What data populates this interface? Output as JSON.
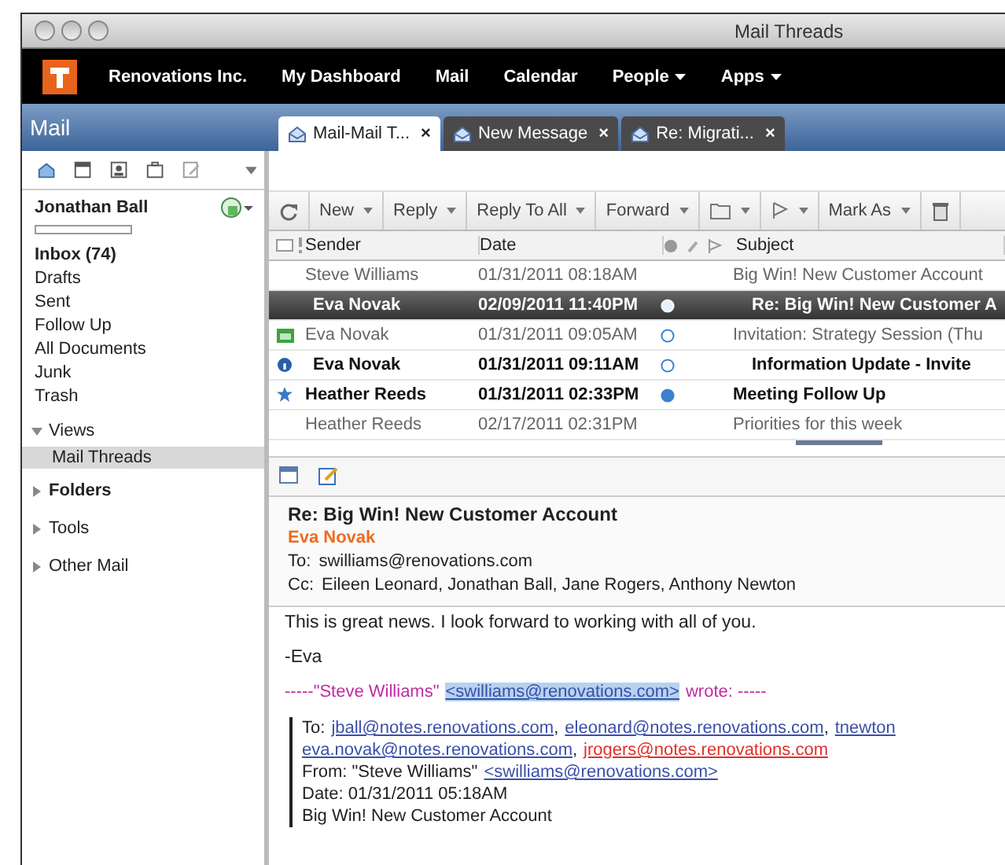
{
  "window": {
    "title": "Mail Threads"
  },
  "nav": {
    "items": [
      {
        "label": "Renovations Inc.",
        "dropdown": false
      },
      {
        "label": "My Dashboard",
        "dropdown": false
      },
      {
        "label": "Mail",
        "dropdown": false
      },
      {
        "label": "Calendar",
        "dropdown": false
      },
      {
        "label": "People",
        "dropdown": true
      },
      {
        "label": "Apps",
        "dropdown": true
      }
    ]
  },
  "app_header": {
    "title": "Mail"
  },
  "tabs": [
    {
      "label": "Mail-Mail T...",
      "selected": true,
      "close": "×"
    },
    {
      "label": "New Message",
      "selected": false,
      "close": "×"
    },
    {
      "label": "Re: Migrati...",
      "selected": false,
      "close": "×"
    }
  ],
  "sidebar": {
    "account": "Jonathan Ball",
    "folders": [
      {
        "label": "Inbox (74)",
        "bold": true
      },
      {
        "label": "Drafts",
        "bold": false
      },
      {
        "label": "Sent",
        "bold": false
      },
      {
        "label": "Follow Up",
        "bold": false
      },
      {
        "label": "All Documents",
        "bold": false
      },
      {
        "label": "Junk",
        "bold": false
      },
      {
        "label": "Trash",
        "bold": false
      }
    ],
    "sections": [
      {
        "label": "Views",
        "expanded": true,
        "bold": false,
        "children": [
          {
            "label": "Mail Threads",
            "selected": true
          }
        ]
      },
      {
        "label": "Folders",
        "expanded": false,
        "bold": true
      },
      {
        "label": "Tools",
        "expanded": false,
        "bold": false
      },
      {
        "label": "Other Mail",
        "expanded": false,
        "bold": false
      }
    ]
  },
  "toolbar": {
    "items": [
      {
        "kind": "refresh",
        "dropdown": false
      },
      {
        "kind": "text",
        "label": "New",
        "dropdown": true
      },
      {
        "kind": "text",
        "label": "Reply",
        "dropdown": true
      },
      {
        "kind": "text",
        "label": "Reply To All",
        "dropdown": true
      },
      {
        "kind": "text",
        "label": "Forward",
        "dropdown": true
      },
      {
        "kind": "folder",
        "dropdown": true
      },
      {
        "kind": "flag",
        "dropdown": true
      },
      {
        "kind": "text",
        "label": "Mark As",
        "dropdown": true
      },
      {
        "kind": "trash",
        "dropdown": false
      }
    ]
  },
  "columns": {
    "sender": "Sender",
    "date": "Date",
    "subject": "Subject"
  },
  "rows": [
    {
      "kind": "plain",
      "sender": "Steve Williams",
      "date": "01/31/2011 08:18AM",
      "subject": "Big Win! New Customer Account",
      "unread": false,
      "selected": false,
      "children": [
        {
          "kind": "plain",
          "sender": "Eva Novak",
          "date": "02/09/2011 11:40PM",
          "subject": "Re: Big Win! New Customer A",
          "unread": true,
          "selected": true,
          "dot_filled": true
        }
      ]
    },
    {
      "kind": "calendar",
      "sender": "Eva Novak",
      "date": "01/31/2011 09:05AM",
      "subject": "Invitation: Strategy Session (Thu",
      "unread": false,
      "selected": false,
      "dot_filled": false,
      "children": [
        {
          "kind": "info",
          "sender": "Eva Novak",
          "date": "01/31/2011 09:11AM",
          "subject": "Information Update - Invite",
          "unread": true,
          "selected": false,
          "dot_filled": false
        }
      ]
    },
    {
      "kind": "star",
      "sender": "Heather Reeds",
      "date": "01/31/2011 02:33PM",
      "subject": "Meeting Follow Up",
      "unread": true,
      "selected": false,
      "dot_filled": true
    },
    {
      "kind": "plain",
      "sender": "Heather Reeds",
      "date": "02/17/2011 02:31PM",
      "subject": "Priorities for this week",
      "unread": false,
      "selected": false
    }
  ],
  "preview": {
    "subject": "Re: Big Win! New Customer Account",
    "from": "Eva Novak",
    "to": {
      "label": "To:",
      "value": "swilliams@renovations.com"
    },
    "cc": {
      "label": "Cc:",
      "value": "Eileen Leonard, Jonathan Ball, Jane Rogers, Anthony Newton"
    },
    "body": [
      "This is great news. I look forward to working with all of you.",
      "-Eva"
    ],
    "quote_header": {
      "before": "-----\"Steve Williams\"",
      "link": "<swilliams@renovations.com>",
      "after": "wrote: -----"
    },
    "quote": {
      "to_label": "To:",
      "to_lines": [
        [
          {
            "address": "jball@notes.renovations.com",
            "after": ",",
            "color": "#3a4fa8"
          },
          {
            "address": "eleonard@notes.renovations.com",
            "after": ",",
            "color": "#3a4fa8"
          },
          {
            "address": "tnewton",
            "color": "#3a4fa8"
          }
        ],
        [
          {
            "address": "eva.novak@notes.renovations.com",
            "after": ",",
            "color": "#3a4fa8"
          },
          {
            "address": "jrogers@notes.renovations.com",
            "color": "#e0302a"
          }
        ]
      ],
      "from_label": "From: \"Steve Williams\"",
      "from_link": "<swilliams@renovations.com>",
      "date": "Date: 01/31/2011 05:18AM",
      "subject": "Big Win! New Customer Account"
    }
  }
}
